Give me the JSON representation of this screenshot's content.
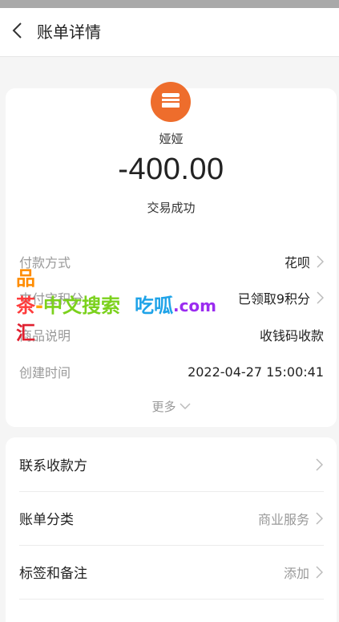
{
  "header": {
    "title": "账单详情"
  },
  "summary": {
    "payee": "娅娅",
    "amount": "-400.00",
    "status": "交易成功"
  },
  "details": [
    {
      "label": "付款方式",
      "value": "花呗",
      "chevron": true
    },
    {
      "label": "支付宝积分",
      "value": "已领取9积分",
      "chevron": true
    },
    {
      "label": "商品说明",
      "value": "收钱码收款",
      "chevron": false
    },
    {
      "label": "创建时间",
      "value": "2022-04-27 15:00:41",
      "chevron": false
    }
  ],
  "more_label": "更多",
  "actions": [
    {
      "label": "联系收款方",
      "value": ""
    },
    {
      "label": "账单分类",
      "value": "商业服务"
    },
    {
      "label": "标签和备注",
      "value": "添加"
    }
  ],
  "watermark": {
    "line1": "品",
    "line2a": "茶",
    "line2b": "-",
    "line2c": "中文搜索",
    "line2d": "吃呱",
    "line2e": ".com",
    "line3": "汇"
  },
  "colors": {
    "accent": "#ee6d2c",
    "muted": "#999999",
    "text": "#222222"
  }
}
